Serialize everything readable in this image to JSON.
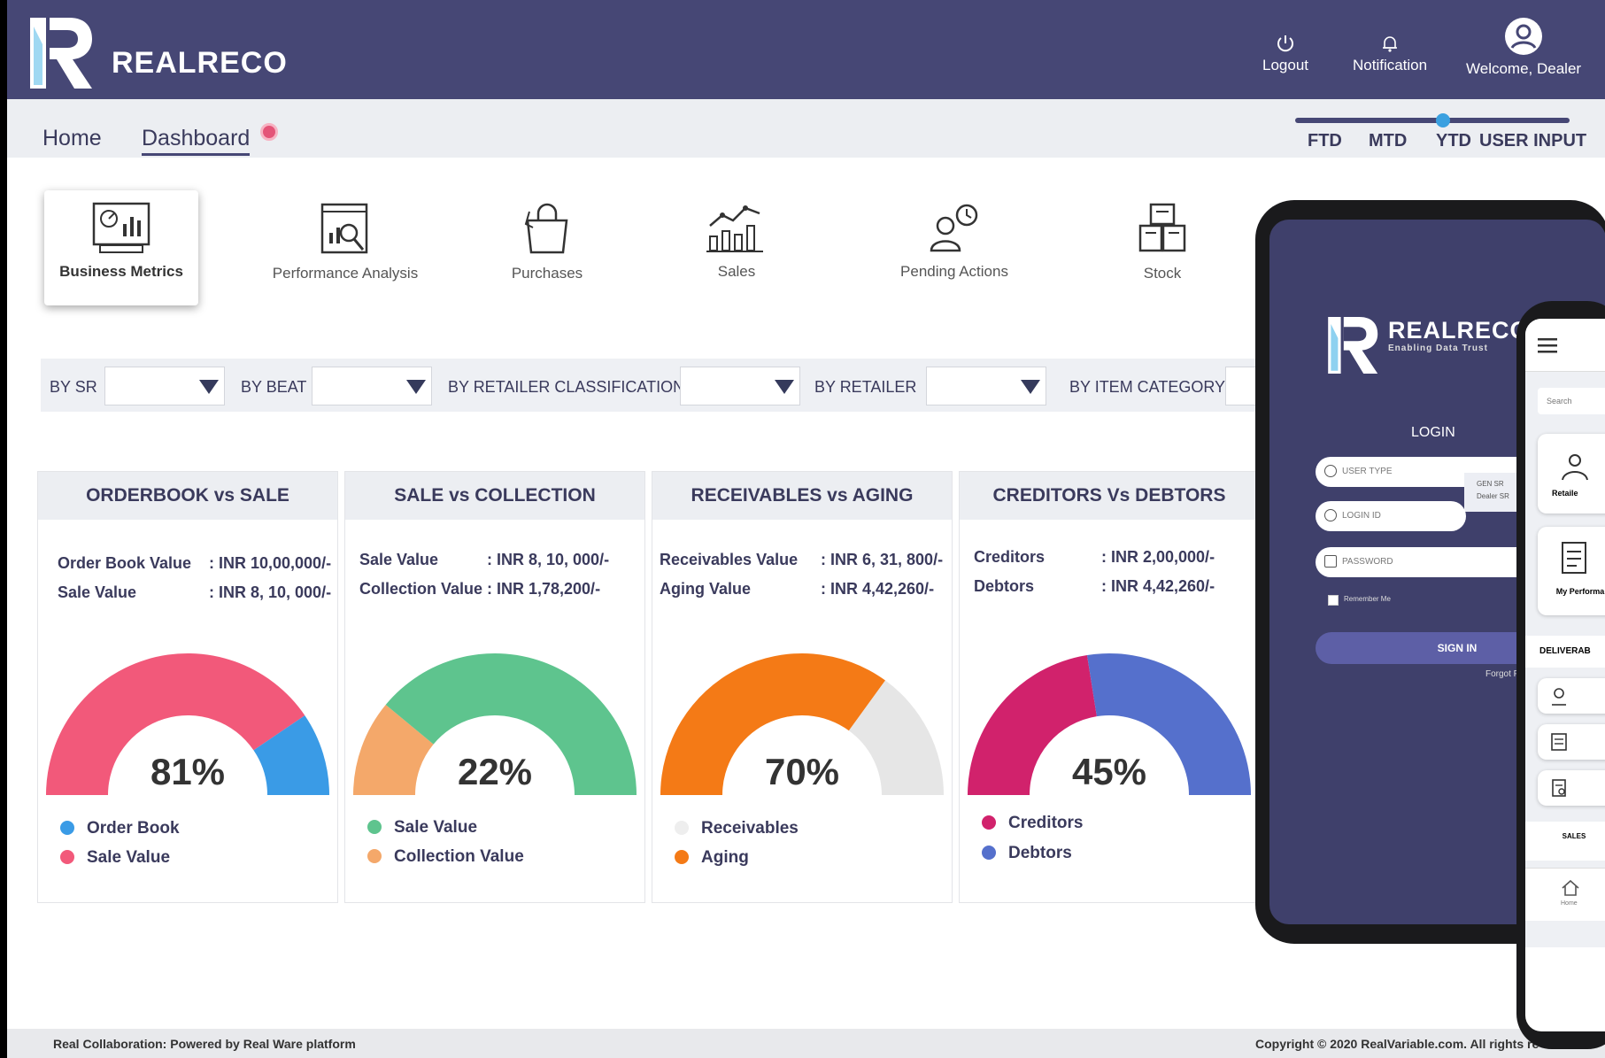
{
  "header": {
    "brand": "REALRECO",
    "logout_label": "Logout",
    "notification_label": "Notification",
    "welcome_label": "Welcome, Dealer"
  },
  "nav": {
    "home": "Home",
    "dashboard": "Dashboard"
  },
  "period": {
    "options": [
      "FTD",
      "MTD",
      "YTD",
      "USER INPUT"
    ],
    "selected": "YTD"
  },
  "menu": [
    {
      "label": "Business Metrics",
      "icon": "business-metrics-icon",
      "selected": true
    },
    {
      "label": "Performance Analysis",
      "icon": "performance-analysis-icon"
    },
    {
      "label": "Purchases",
      "icon": "shopping-bag-icon"
    },
    {
      "label": "Sales",
      "icon": "sales-chart-icon"
    },
    {
      "label": "Pending Actions",
      "icon": "pending-clock-icon"
    },
    {
      "label": "Stock",
      "icon": "stock-boxes-icon"
    }
  ],
  "filters": [
    {
      "label": "BY SR",
      "value": ""
    },
    {
      "label": "BY BEAT",
      "value": ""
    },
    {
      "label": "BY RETAILER CLASSIFICATION",
      "value": ""
    },
    {
      "label": "BY RETAILER",
      "value": ""
    },
    {
      "label": "BY ITEM CATEGORY",
      "value": ""
    }
  ],
  "cards": [
    {
      "title": "ORDERBOOK vs SALE",
      "rows": [
        {
          "k": "Order Book Value",
          "v": ": INR 10,00,000/-"
        },
        {
          "k": "Sale Value",
          "v": ": INR 8, 10, 000/-"
        }
      ],
      "percent": "81%",
      "fraction": 0.81,
      "fill_color": "#f2597a",
      "rest_color": "#3a9be6",
      "legend": [
        {
          "label": "Order Book",
          "color": "#3a9be6"
        },
        {
          "label": "Sale Value",
          "color": "#f2597a"
        }
      ]
    },
    {
      "title": "SALE vs COLLECTION",
      "rows": [
        {
          "k": "Sale Value",
          "v": ": INR 8, 10, 000/-"
        },
        {
          "k": "Collection Value",
          "v": ": INR 1,78,200/-"
        }
      ],
      "percent": "22%",
      "fraction": 0.22,
      "fill_color": "#f4a86a",
      "rest_color": "#5ec48e",
      "legend": [
        {
          "label": "Sale Value",
          "color": "#5ec48e"
        },
        {
          "label": "Collection Value",
          "color": "#f4a86a"
        }
      ]
    },
    {
      "title": "RECEIVABLES vs AGING",
      "rows": [
        {
          "k": "Receivables Value",
          "v": ": INR 6, 31, 800/-"
        },
        {
          "k": "Aging Value",
          "v": ": INR 4,42,260/-"
        }
      ],
      "percent": "70%",
      "fraction": 0.7,
      "fill_color": "#f47a16",
      "rest_color": "#e6e6e6",
      "legend": [
        {
          "label": "Receivables",
          "color": "#eeeeee"
        },
        {
          "label": "Aging",
          "color": "#f47a16"
        }
      ]
    },
    {
      "title": "CREDITORS Vs DEBTORS",
      "rows": [
        {
          "k": "Creditors",
          "v": ": INR 2,00,000/-"
        },
        {
          "k": "Debtors",
          "v": ": INR 4,42,260/-"
        }
      ],
      "percent": "45%",
      "fraction": 0.45,
      "fill_color": "#d1226c",
      "rest_color": "#5570cc",
      "legend": [
        {
          "label": "Creditors",
          "color": "#d1226c"
        },
        {
          "label": "Debtors",
          "color": "#5570cc"
        }
      ]
    }
  ],
  "phone_login": {
    "brand": "REALRECO",
    "tagline": "Enabling Data Trust",
    "title": "LOGIN",
    "username_placeholder": "USER TYPE",
    "login_id_placeholder": "LOGIN ID",
    "password_placeholder": "PASSWORD",
    "remember_label": "Remember Me",
    "signin_label": "SIGN IN",
    "forgot_label": "Forgot Pa",
    "dropdown_options": [
      "GEN SR",
      "Dealer SR"
    ]
  },
  "phone_app": {
    "search_placeholder": "Search",
    "retailer_label": "Retaile",
    "performance_label": "My Performa",
    "deliverables_label": "DELIVERAB",
    "sales_label": "SALES",
    "home_label": "Home"
  },
  "footer": {
    "left": "Real Collaboration: Powered by Real Ware platform",
    "right": "Copyright © 2020 RealVariable.com. All rights re"
  }
}
